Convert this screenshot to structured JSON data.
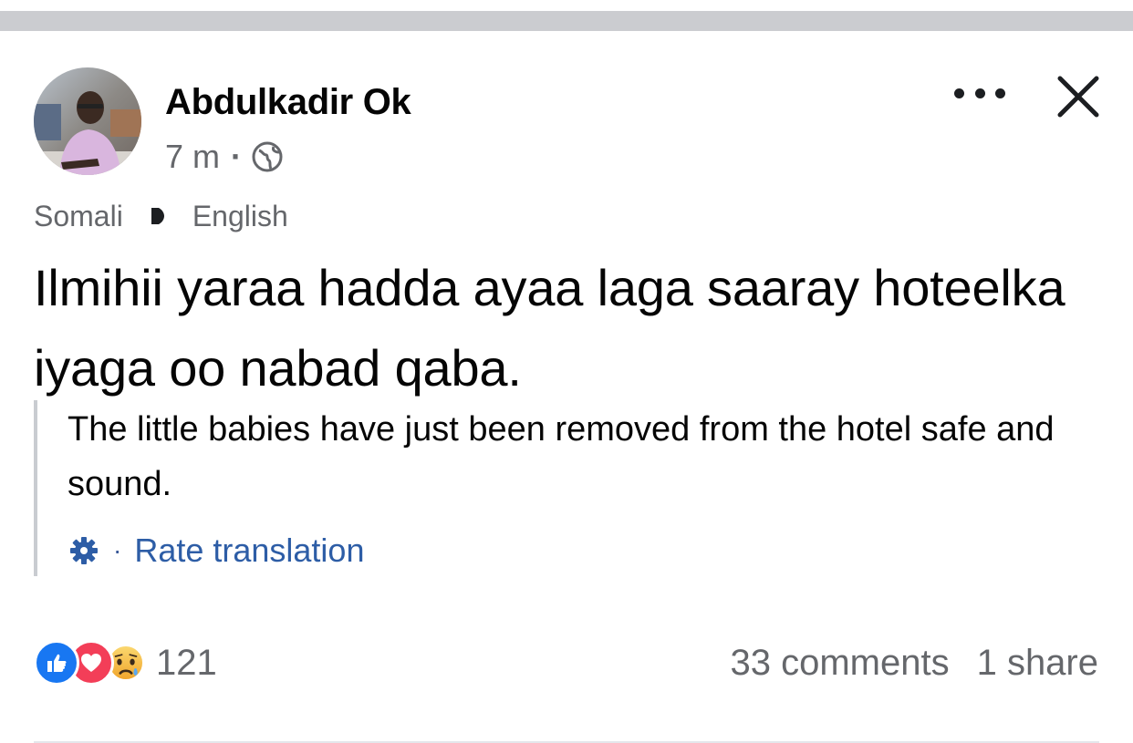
{
  "post": {
    "author": "Abdulkadir Ok",
    "time": "7 m",
    "separator": "·",
    "source_language": "Somali",
    "target_language": "English",
    "original_text": "Ilmihii yaraa hadda ayaa laga saaray hoteelka iyaga oo nabad qaba.",
    "translated_text": "The little babies have just been removed from the hotel safe and sound.",
    "rate_separator": "·",
    "rate_label": "Rate translation",
    "reaction_count": "121",
    "comments": "33 comments",
    "shares": "1 share"
  },
  "icons": {
    "avatar": "avatar",
    "audience": "globe-icon",
    "more": "more-icon",
    "close": "close-icon",
    "translate_arrow": "arrow-right-icon",
    "settings": "gear-icon",
    "reactions": [
      "like-icon",
      "love-icon",
      "sad-icon"
    ]
  },
  "colors": {
    "link": "#2d5da6",
    "secondary_text": "#65676b",
    "like": "#1877f2",
    "love": "#f33e58"
  }
}
